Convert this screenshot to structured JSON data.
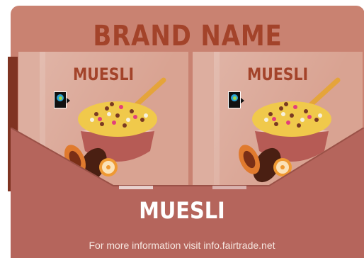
{
  "box": {
    "color": "#c98271",
    "dark": "#7f3322"
  },
  "brand": {
    "name": "BRAND NAME",
    "color": "#a3432a"
  },
  "panels": [
    {
      "label": "MUESLI",
      "badge_icon": "fairtrade-icon"
    },
    {
      "label": "MUESLI",
      "badge_icon": "fairtrade-icon"
    }
  ],
  "product": {
    "title": "MUESLI",
    "info": "For more information visit info.fairtrade.net"
  }
}
